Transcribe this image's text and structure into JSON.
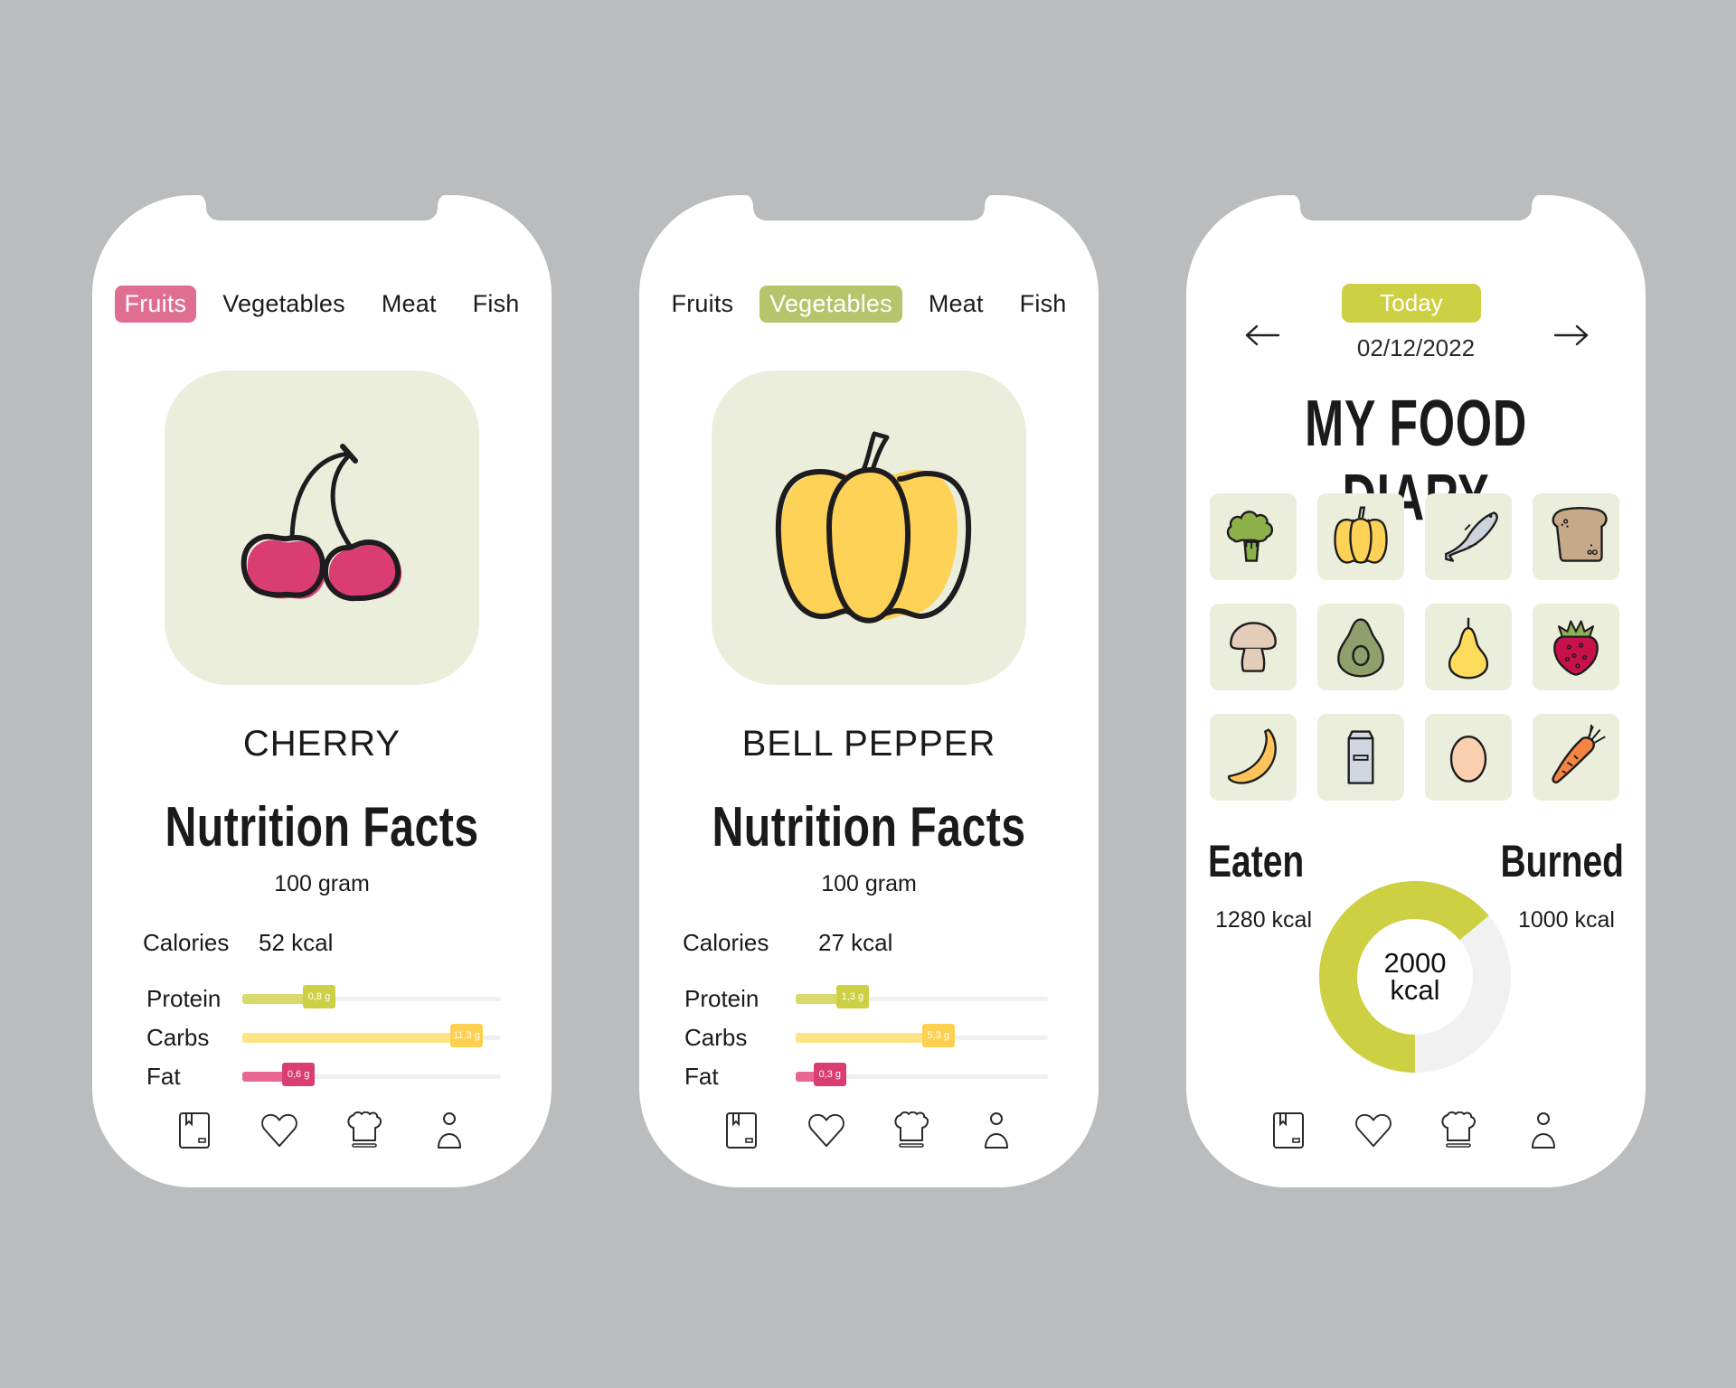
{
  "colors": {
    "background": "#bbbcbe",
    "tile": "#ebeedb",
    "fruits_accent": "#e06e92",
    "vegetables_accent": "#b6c46c",
    "today_accent": "#cdd042",
    "protein": "#cdd042",
    "protein_light": "#d8da6c",
    "carbs": "#fdd04f",
    "carbs_light": "#fde486",
    "fat": "#d93d72",
    "fat_light": "#e76791",
    "donut_eaten": "#cdd042",
    "donut_rest": "#f0f1f0"
  },
  "phones": [
    {
      "tabs": [
        {
          "label": "Fruits",
          "active": true
        },
        {
          "label": "Vegetables",
          "active": false
        },
        {
          "label": "Meat",
          "active": false
        },
        {
          "label": "Fish",
          "active": false
        }
      ],
      "hero_icon": "cherry-icon",
      "food_name": "CHERRY",
      "title": "Nutrition Facts",
      "serving": "100 gram",
      "calories_label": "Calories",
      "calories_value": "52 kcal",
      "macros": [
        {
          "label": "Protein",
          "value": "0,8 g",
          "fill_pct": 36,
          "key": "protein"
        },
        {
          "label": "Carbs",
          "value": "11,3 g",
          "fill_pct": 93,
          "key": "carbs"
        },
        {
          "label": "Fat",
          "value": "0,6 g",
          "fill_pct": 28,
          "key": "fat"
        }
      ]
    },
    {
      "tabs": [
        {
          "label": "Fruits",
          "active": false
        },
        {
          "label": "Vegetables",
          "active": true
        },
        {
          "label": "Meat",
          "active": false
        },
        {
          "label": "Fish",
          "active": false
        }
      ],
      "hero_icon": "bell-pepper-icon",
      "food_name": "BELL PEPPER",
      "title": "Nutrition Facts",
      "serving": "100 gram",
      "calories_label": "Calories",
      "calories_value": "27 kcal",
      "macros": [
        {
          "label": "Protein",
          "value": "1,3 g",
          "fill_pct": 29,
          "key": "protein"
        },
        {
          "label": "Carbs",
          "value": "5,3 g",
          "fill_pct": 63,
          "key": "carbs"
        },
        {
          "label": "Fat",
          "value": "0,3 g",
          "fill_pct": 20,
          "key": "fat"
        }
      ]
    }
  ],
  "diary": {
    "prev_icon": "arrow-left-icon",
    "next_icon": "arrow-right-icon",
    "today_label": "Today",
    "date": "02/12/2022",
    "title": "MY FOOD DIARY",
    "foods": [
      "broccoli",
      "bell-pepper",
      "fish",
      "bread",
      "mushroom",
      "avocado",
      "pear",
      "strawberry",
      "banana",
      "milk-carton",
      "egg",
      "carrot"
    ],
    "eaten_label": "Eaten",
    "eaten_value": "1280 kcal",
    "burned_label": "Burned",
    "burned_value": "1000 kcal",
    "goal_number": "2000",
    "goal_unit": "kcal",
    "eaten_fraction": 0.64
  },
  "bottom_nav": [
    {
      "name": "recipe-book-icon"
    },
    {
      "name": "heart-icon"
    },
    {
      "name": "chef-hat-icon"
    },
    {
      "name": "profile-icon"
    }
  ]
}
